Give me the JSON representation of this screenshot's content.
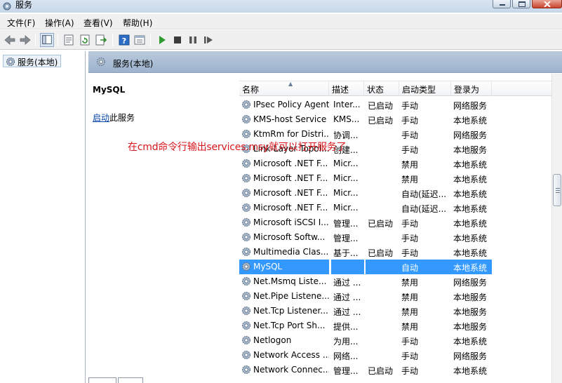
{
  "window": {
    "title": "服务"
  },
  "menu": [
    {
      "label": "文件(F)"
    },
    {
      "label": "操作(A)"
    },
    {
      "label": "查看(V)"
    },
    {
      "label": "帮助(H)"
    }
  ],
  "toolbar": {
    "icons": [
      "back-icon",
      "forward-icon",
      "show-tree-icon",
      "properties-icon",
      "refresh-icon",
      "export-list-icon",
      "help-icon",
      "view-icon",
      "start-service-icon",
      "stop-service-icon",
      "pause-service-icon",
      "restart-service-icon"
    ]
  },
  "tree": {
    "root_label": "服务(本地)"
  },
  "pane_header": {
    "title": "服务(本地)"
  },
  "details": {
    "service_name": "MySQL",
    "start_link": "启动",
    "start_suffix": "此服务"
  },
  "annotation": {
    "text": "在cmd命令行输出services.msy就可以打开服务了",
    "color": "#d8151b"
  },
  "columns": {
    "name": "名称",
    "description": "描述",
    "status": "状态",
    "startup_type": "启动类型",
    "logon_as": "登录为"
  },
  "services": [
    {
      "name": "IPsec Policy Agent",
      "desc": "Inter...",
      "status": "已启动",
      "start": "手动",
      "logon": "网络服务"
    },
    {
      "name": "KMS-host Service",
      "desc": "KMS...",
      "status": "已启动",
      "start": "手动",
      "logon": "本地系统"
    },
    {
      "name": "KtmRm for Distri...",
      "desc": "协调...",
      "status": "",
      "start": "手动",
      "logon": "网络服务"
    },
    {
      "name": "Link-Layer Topol...",
      "desc": "创建...",
      "status": "",
      "start": "手动",
      "logon": "本地服务"
    },
    {
      "name": "Microsoft .NET F...",
      "desc": "Micr...",
      "status": "",
      "start": "禁用",
      "logon": "本地系统"
    },
    {
      "name": "Microsoft .NET F...",
      "desc": "Micr...",
      "status": "",
      "start": "禁用",
      "logon": "本地系统"
    },
    {
      "name": "Microsoft .NET F...",
      "desc": "Micr...",
      "status": "",
      "start": "自动(延迟...",
      "logon": "本地系统"
    },
    {
      "name": "Microsoft .NET F...",
      "desc": "Micr...",
      "status": "",
      "start": "自动(延迟...",
      "logon": "本地系统"
    },
    {
      "name": "Microsoft iSCSI I...",
      "desc": "管理...",
      "status": "已启动",
      "start": "手动",
      "logon": "本地系统"
    },
    {
      "name": "Microsoft Softw...",
      "desc": "管理...",
      "status": "",
      "start": "手动",
      "logon": "本地系统"
    },
    {
      "name": "Multimedia Clas...",
      "desc": "基于...",
      "status": "已启动",
      "start": "手动",
      "logon": "本地系统"
    },
    {
      "name": "MySQL",
      "desc": "",
      "status": "",
      "start": "自动",
      "logon": "本地系统",
      "selected": true
    },
    {
      "name": "Net.Msmq Liste...",
      "desc": "通过 ...",
      "status": "",
      "start": "禁用",
      "logon": "网络服务"
    },
    {
      "name": "Net.Pipe Listene...",
      "desc": "通过 ...",
      "status": "",
      "start": "禁用",
      "logon": "本地服务"
    },
    {
      "name": "Net.Tcp Listener...",
      "desc": "通过 ...",
      "status": "",
      "start": "禁用",
      "logon": "本地服务"
    },
    {
      "name": "Net.Tcp Port Sh...",
      "desc": "提供...",
      "status": "",
      "start": "禁用",
      "logon": "本地服务"
    },
    {
      "name": "Netlogon",
      "desc": "为用...",
      "status": "",
      "start": "手动",
      "logon": "本地系统"
    },
    {
      "name": "Network Access ...",
      "desc": "网络...",
      "status": "",
      "start": "手动",
      "logon": "网络服务"
    },
    {
      "name": "Network Connec...",
      "desc": "管理...",
      "status": "已启动",
      "start": "手动",
      "logon": "本地系统"
    }
  ]
}
